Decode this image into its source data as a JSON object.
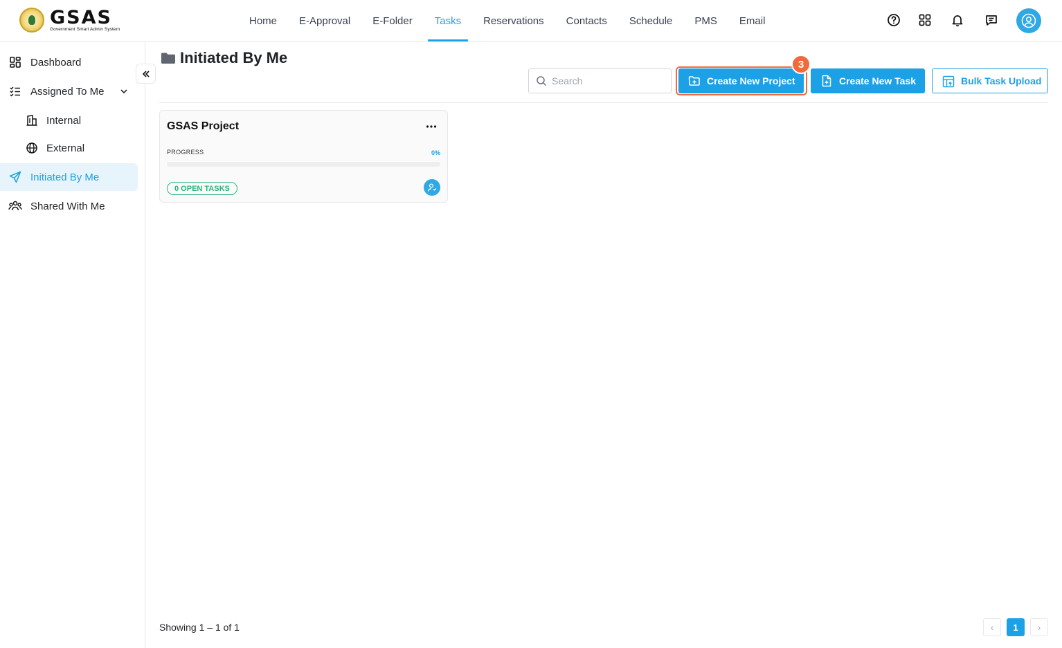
{
  "app": {
    "logo_text": "GSAS",
    "logo_subtitle": "Government Smart Admin System"
  },
  "nav": {
    "items": [
      {
        "label": "Home"
      },
      {
        "label": "E-Approval"
      },
      {
        "label": "E-Folder"
      },
      {
        "label": "Tasks"
      },
      {
        "label": "Reservations"
      },
      {
        "label": "Contacts"
      },
      {
        "label": "Schedule"
      },
      {
        "label": "PMS"
      },
      {
        "label": "Email"
      }
    ],
    "active": "Tasks"
  },
  "top_icons": [
    "help-icon",
    "apps-grid-icon",
    "bell-icon",
    "chat-icon",
    "user-avatar-icon"
  ],
  "sidebar": {
    "items": [
      {
        "label": "Dashboard",
        "icon": "dashboard-icon"
      },
      {
        "label": "Assigned To Me",
        "icon": "checklist-icon"
      },
      {
        "label": "Internal",
        "icon": "building-icon"
      },
      {
        "label": "External",
        "icon": "globe-icon"
      },
      {
        "label": "Initiated By Me",
        "icon": "send-icon"
      },
      {
        "label": "Shared With Me",
        "icon": "users-icon"
      }
    ],
    "active": "Initiated By Me"
  },
  "page": {
    "title": "Initiated By Me",
    "search_placeholder": "Search"
  },
  "toolbar": {
    "create_project_label": "Create New Project",
    "create_task_label": "Create New Task",
    "bulk_upload_label": "Bulk Task Upload",
    "step_badge": "3"
  },
  "projects": [
    {
      "name": "GSAS Project",
      "progress_label": "PROGRESS",
      "progress_text": "0%",
      "progress_value": 0,
      "open_tasks_label": "0 OPEN TASKS"
    }
  ],
  "footer": {
    "showing_text": "Showing 1 – 1 of 1",
    "current_page": "1",
    "prev_symbol": "‹",
    "next_symbol": "›"
  },
  "colors": {
    "accent": "#1da1e6",
    "highlight": "#f26a3a",
    "success": "#2fb37a"
  }
}
